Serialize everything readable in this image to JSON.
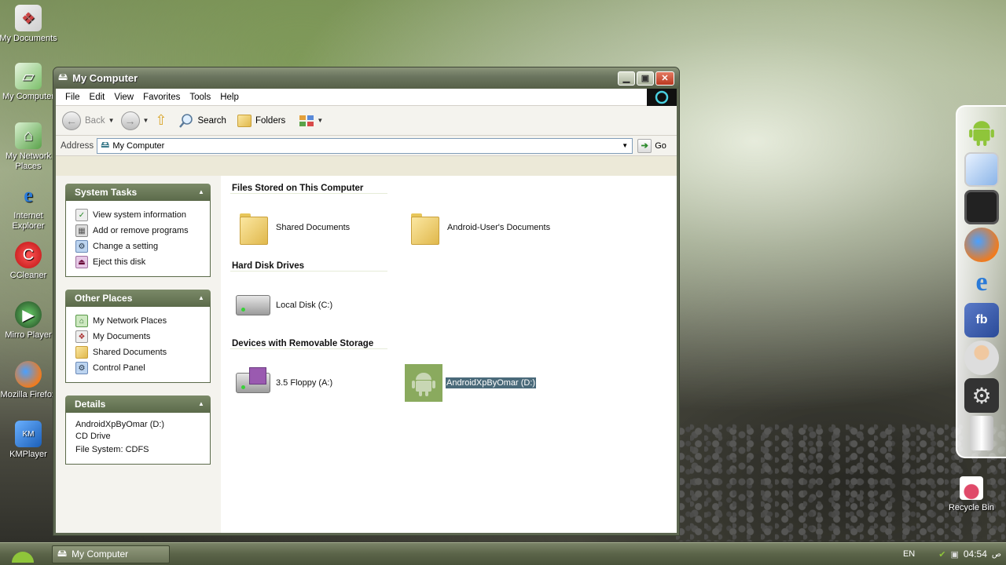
{
  "desktop": {
    "icons": [
      {
        "label": "My Documents",
        "icon": "documents-icon"
      },
      {
        "label": "My Computer",
        "icon": "computer-icon"
      },
      {
        "label": "My Network Places",
        "icon": "network-icon"
      },
      {
        "label": "Internet Explorer",
        "icon": "ie-icon"
      },
      {
        "label": "CCleaner",
        "icon": "ccleaner-icon"
      },
      {
        "label": "Mirro Player",
        "icon": "mirro-player-icon"
      },
      {
        "label": "Mozilla Firefox",
        "icon": "firefox-icon"
      },
      {
        "label": "KMPlayer",
        "icon": "kmplayer-icon"
      }
    ],
    "recycle_bin": "Recycle Bin"
  },
  "window": {
    "title": "My Computer",
    "menu": [
      "File",
      "Edit",
      "View",
      "Favorites",
      "Tools",
      "Help"
    ],
    "toolbar": {
      "back": "Back",
      "search": "Search",
      "folders": "Folders"
    },
    "address": {
      "label": "Address",
      "value": "My Computer",
      "go": "Go"
    },
    "side": {
      "system_tasks": {
        "title": "System Tasks",
        "items": [
          "View system information",
          "Add or remove programs",
          "Change a setting",
          "Eject this disk"
        ]
      },
      "other_places": {
        "title": "Other Places",
        "items": [
          "My Network Places",
          "My Documents",
          "Shared Documents",
          "Control Panel"
        ]
      },
      "details": {
        "title": "Details",
        "name": "AndroidXpByOmar (D:)",
        "type": "CD Drive",
        "fs": "File System: CDFS"
      }
    },
    "groups": {
      "stored": {
        "title": "Files Stored on This Computer",
        "items": [
          "Shared Documents",
          "Android-User's Documents"
        ]
      },
      "hdd": {
        "title": "Hard Disk Drives",
        "items": [
          "Local Disk (C:)"
        ]
      },
      "removable": {
        "title": "Devices with Removable Storage",
        "items": [
          "3.5 Floppy (A:)",
          "AndroidXpByOmar (D:)"
        ]
      }
    }
  },
  "dock": [
    "android-icon",
    "monitor-icon",
    "tablet-icon",
    "firefox-icon",
    "ie-icon",
    "facebook-icon",
    "user-support-icon",
    "settings-gear-icon",
    "trash-can-icon"
  ],
  "taskbar": {
    "task": "My Computer",
    "lang": "EN",
    "clock": "04:54",
    "ampm": "ص"
  },
  "colors": {
    "titlebar": "#6c7660",
    "panel_header": "#6b7a58",
    "selection": "#4a6a7a",
    "taskbar": "#5b6449"
  }
}
